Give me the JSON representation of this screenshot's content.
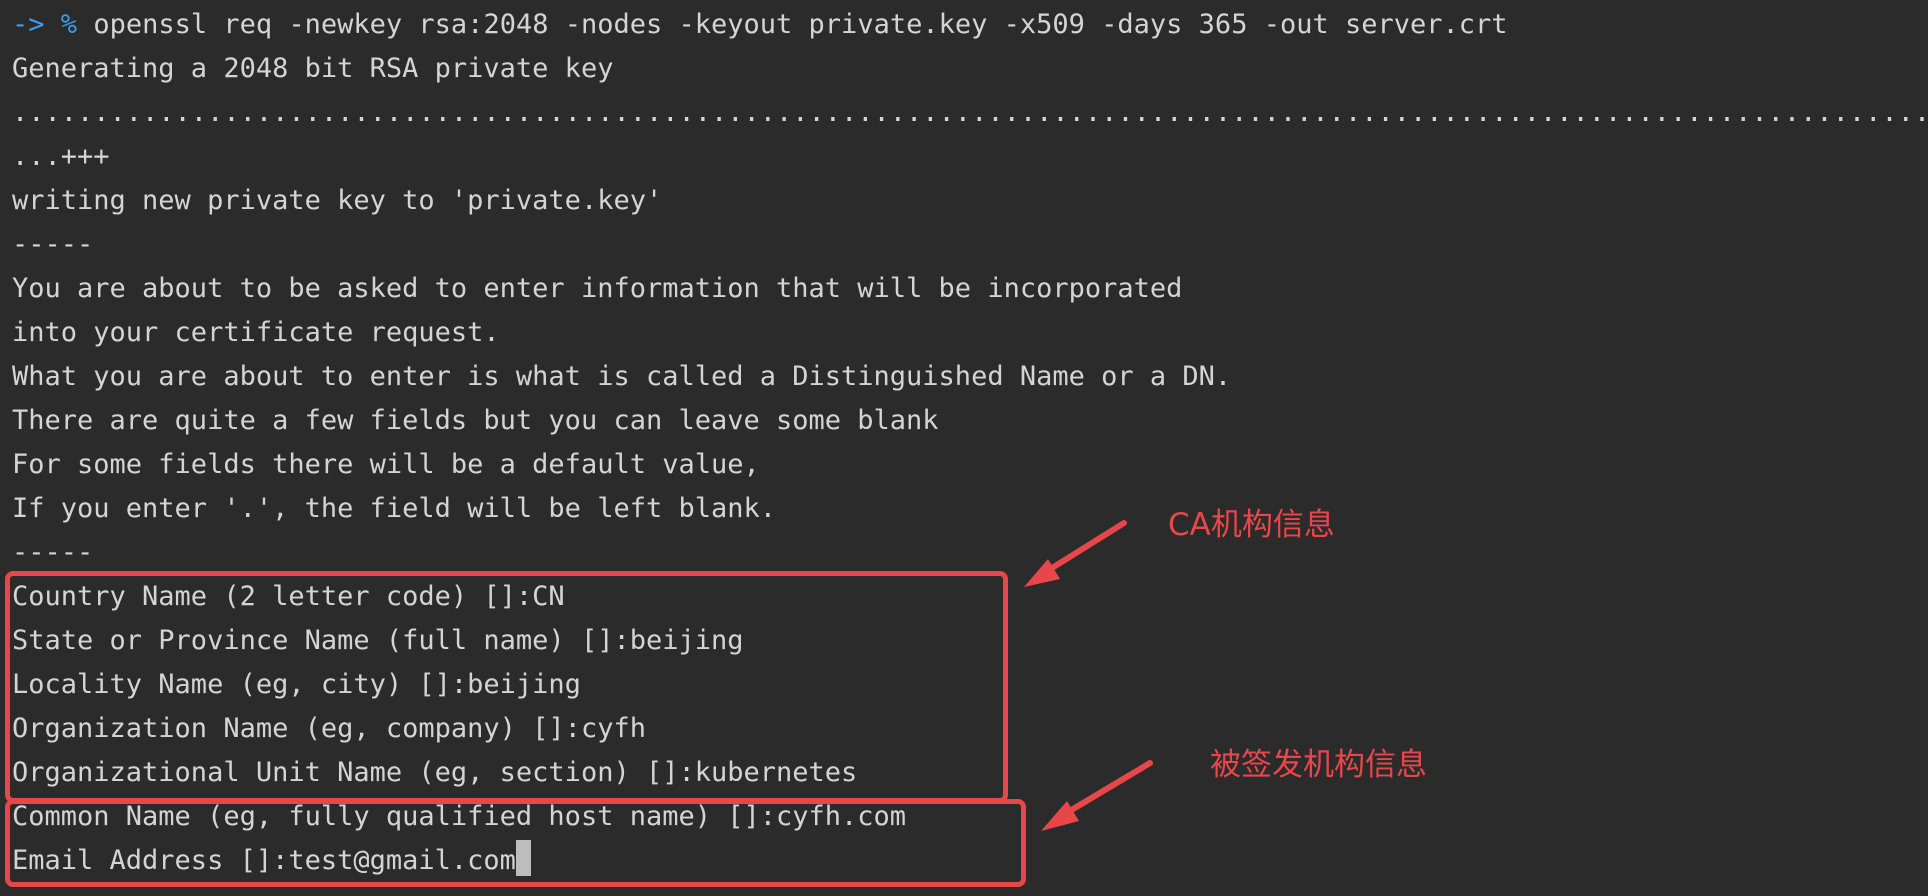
{
  "terminal": {
    "prompt": {
      "arrow": "->",
      "symbol": "%",
      "command": "openssl req -newkey rsa:2048 -nodes -keyout private.key -x509 -days 365 -out server.crt"
    },
    "lines": [
      "Generating a 2048 bit RSA private key",
      "..............................................................................................................................................",
      "...+++",
      "writing new private key to 'private.key'",
      "-----",
      "You are about to be asked to enter information that will be incorporated",
      "into your certificate request.",
      "What you are about to enter is what is called a Distinguished Name or a DN.",
      "There are quite a few fields but you can leave some blank",
      "For some fields there will be a default value,",
      "If you enter '.', the field will be left blank.",
      "-----",
      "Country Name (2 letter code) []:CN",
      "State or Province Name (full name) []:beijing",
      "Locality Name (eg, city) []:beijing",
      "Organization Name (eg, company) []:cyfh",
      "Organizational Unit Name (eg, section) []:kubernetes",
      "Common Name (eg, fully qualified host name) []:cyfh.com",
      "Email Address []:test@gmail.com"
    ]
  },
  "annotations": {
    "ca_label": "CA机构信息",
    "issued_label": "被签发机构信息"
  },
  "colors": {
    "background": "#2b2b2b",
    "text": "#d4d4d4",
    "prompt": "#3b9cf0",
    "annotation": "#e8474a"
  }
}
